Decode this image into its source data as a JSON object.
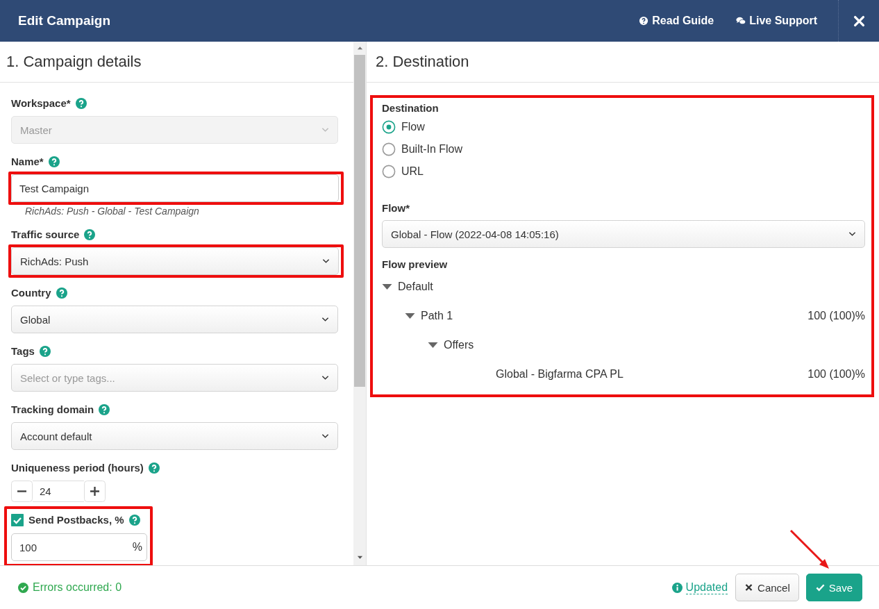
{
  "header": {
    "title": "Edit Campaign",
    "links": [
      {
        "kind": "guide",
        "label": "Read Guide"
      },
      {
        "kind": "support",
        "label": "Live Support"
      }
    ]
  },
  "campaign": {
    "title": "1. Campaign details",
    "fields": [
      {
        "kind": "select",
        "label": "Workspace*",
        "value": "Master",
        "disabled": true,
        "highlighted": false
      },
      {
        "kind": "text",
        "label": "Name*",
        "value": "Test Campaign",
        "hint": "RichAds: Push - Global - Test Campaign",
        "highlighted": true
      },
      {
        "kind": "select",
        "label": "Traffic source",
        "value": "RichAds: Push",
        "disabled": false,
        "highlighted": true
      },
      {
        "kind": "select",
        "label": "Country",
        "value": "Global",
        "disabled": false,
        "highlighted": false
      },
      {
        "kind": "select",
        "label": "Tags",
        "placeholder": "Select or type tags...",
        "disabled": false,
        "highlighted": false
      },
      {
        "kind": "select",
        "label": "Tracking domain",
        "value": "Account default",
        "disabled": false,
        "highlighted": false
      },
      {
        "kind": "stepper",
        "label": "Uniqueness period (hours)",
        "value": "24",
        "highlighted": false
      },
      {
        "kind": "percent",
        "label": "Send Postbacks, %",
        "checked": true,
        "value": "100",
        "unit": "%",
        "highlighted": true
      }
    ]
  },
  "destination": {
    "title": "2. Destination",
    "highlighted": true,
    "label": "Destination",
    "options": [
      {
        "label": "Flow",
        "selected": true
      },
      {
        "label": "Built-In Flow",
        "selected": false
      },
      {
        "label": "URL",
        "selected": false
      }
    ],
    "flow_label": "Flow*",
    "flow_value": "Global - Flow (2022-04-08 14:05:16)",
    "preview_label": "Flow preview",
    "preview_tree": [
      {
        "label": "Default",
        "expanded": true,
        "children": [
          {
            "label": "Path 1",
            "share": "100 (100)%",
            "expanded": true,
            "children": [
              {
                "label": "Offers",
                "expanded": true,
                "children": [
                  {
                    "label": "Global - Bigfarma CPA PL",
                    "share": "100 (100)%"
                  }
                ]
              }
            ]
          }
        ]
      }
    ]
  },
  "footer": {
    "errors": "Errors occurred: 0",
    "status": "Updated",
    "buttons": [
      {
        "kind": "cancel",
        "label": "Cancel"
      },
      {
        "kind": "save",
        "label": "Save",
        "highlighted": true
      }
    ]
  }
}
